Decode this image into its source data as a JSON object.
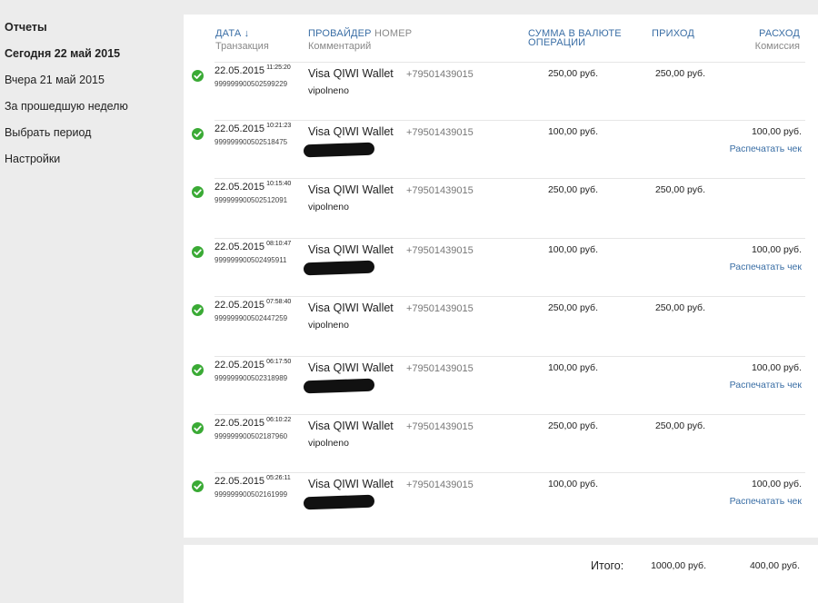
{
  "sidebar": {
    "items": [
      {
        "label": "Отчеты",
        "bold": true
      },
      {
        "label": "Сегодня 22 май 2015",
        "bold": true
      },
      {
        "label": "Вчера 21 май 2015",
        "bold": false
      },
      {
        "label": "За прошедшую неделю",
        "bold": false
      },
      {
        "label": "Выбрать период",
        "bold": false
      },
      {
        "label": "Настройки",
        "bold": false
      }
    ]
  },
  "table": {
    "headers": {
      "date": "ДАТА ↓",
      "transaction": "Транзакция",
      "provider": "ПРОВАЙДЕР",
      "number": "НОМЕР",
      "comment": "Комментарий",
      "sum_line1": "СУММА В ВАЛЮТЕ",
      "sum_line2": "ОПЕРАЦИИ",
      "income": "ПРИХОД",
      "expense": "РАСХОД",
      "commission": "Комиссия"
    },
    "rows": [
      {
        "date": "22.05.2015",
        "time": "11:25:20",
        "txn": "9999999005025992​29",
        "provider": "Visa QIWI Wallet",
        "phone": "+79501439015",
        "comment": "vipolneno",
        "redacted": false,
        "amount": "250,00 руб.",
        "income": "250,00 руб.",
        "expense": "",
        "print": ""
      },
      {
        "date": "22.05.2015",
        "time": "10:21:23",
        "txn": "999999900502518475",
        "provider": "Visa QIWI Wallet",
        "phone": "+79501439015",
        "comment": "",
        "redacted": true,
        "amount": "100,00 руб.",
        "income": "",
        "expense": "100,00 руб.",
        "print": "Распечатать чек"
      },
      {
        "date": "22.05.2015",
        "time": "10:15:40",
        "txn": "999999900502512091",
        "provider": "Visa QIWI Wallet",
        "phone": "+79501439015",
        "comment": "vipolneno",
        "redacted": false,
        "amount": "250,00 руб.",
        "income": "250,00 руб.",
        "expense": "",
        "print": ""
      },
      {
        "date": "22.05.2015",
        "time": "08:10:47",
        "txn": "999999900502495911",
        "provider": "Visa QIWI Wallet",
        "phone": "+79501439015",
        "comment": "",
        "redacted": true,
        "amount": "100,00 руб.",
        "income": "",
        "expense": "100,00 руб.",
        "print": "Распечатать чек"
      },
      {
        "date": "22.05.2015",
        "time": "07:58:40",
        "txn": "999999900502447259",
        "provider": "Visa QIWI Wallet",
        "phone": "+79501439015",
        "comment": "vipolneno",
        "redacted": false,
        "amount": "250,00 руб.",
        "income": "250,00 руб.",
        "expense": "",
        "print": ""
      },
      {
        "date": "22.05.2015",
        "time": "06:17:50",
        "txn": "999999900502318989",
        "provider": "Visa QIWI Wallet",
        "phone": "+79501439015",
        "comment": "",
        "redacted": true,
        "amount": "100,00 руб.",
        "income": "",
        "expense": "100,00 руб.",
        "print": "Распечатать чек"
      },
      {
        "date": "22.05.2015",
        "time": "06:10:22",
        "txn": "999999900502187960",
        "provider": "Visa QIWI Wallet",
        "phone": "+79501439015",
        "comment": "vipolneno",
        "redacted": false,
        "amount": "250,00 руб.",
        "income": "250,00 руб.",
        "expense": "",
        "print": ""
      },
      {
        "date": "22.05.2015",
        "time": "05:26:11",
        "txn": "999999900502161999",
        "provider": "Visa QIWI Wallet",
        "phone": "+79501439015",
        "comment": "",
        "redacted": true,
        "amount": "100,00 руб.",
        "income": "",
        "expense": "100,00 руб.",
        "print": "Распечатать чек"
      }
    ]
  },
  "footer": {
    "total_label": "Итого:",
    "total_income": "1000,00 руб.",
    "total_expense": "400,00 руб."
  },
  "colors": {
    "accent": "#3a6ea5",
    "check": "#3aaa35",
    "background": "#ececec"
  }
}
